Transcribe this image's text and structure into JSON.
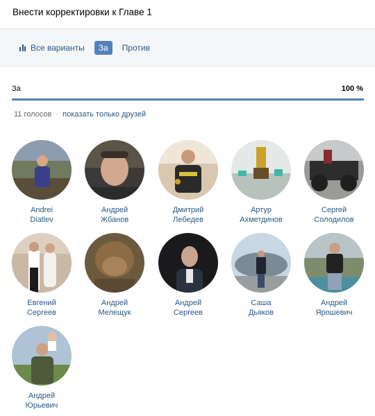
{
  "header": {
    "title": "Внести корректировки к Главе 1"
  },
  "tabs": [
    {
      "label": "Все варианты",
      "icon": "bar-chart-icon",
      "active": false
    },
    {
      "label": "За",
      "active": true
    },
    {
      "label": "Против",
      "active": false
    }
  ],
  "result": {
    "label": "За",
    "percent": "100 %",
    "fraction": 1.0
  },
  "meta": {
    "votes": "11 голосов",
    "separator": "·",
    "friends_link": "показать только друзей"
  },
  "voters": [
    {
      "first": "Andrei",
      "last": "Diatlev"
    },
    {
      "first": "Андрей",
      "last": "Жбанов"
    },
    {
      "first": "Дмитрий",
      "last": "Лебедев"
    },
    {
      "first": "Артур",
      "last": "Ахметдинов"
    },
    {
      "first": "Сергей",
      "last": "Солодилов"
    },
    {
      "first": "Евгений",
      "last": "Сергеев"
    },
    {
      "first": "Андрей",
      "last": "Мелещук"
    },
    {
      "first": "Андрей",
      "last": "Сергеев"
    },
    {
      "first": "Саша",
      "last": "Дьяков"
    },
    {
      "first": "Андрей",
      "last": "Ярошевич"
    },
    {
      "first": "Андрей",
      "last": "Юрьевич"
    }
  ],
  "colors": {
    "accent": "#5181b8",
    "link": "#2a5885",
    "muted": "#656565"
  }
}
